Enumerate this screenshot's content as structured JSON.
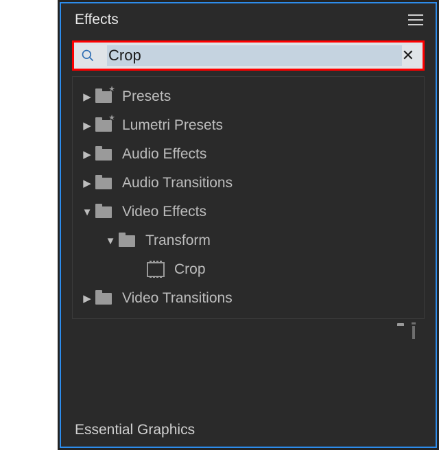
{
  "panel": {
    "title": "Effects"
  },
  "search": {
    "value": "Crop"
  },
  "tree": {
    "presets": "Presets",
    "lumetri": "Lumetri Presets",
    "audioFx": "Audio Effects",
    "audioTr": "Audio Transitions",
    "videoFx": "Video Effects",
    "transform": "Transform",
    "crop": "Crop",
    "videoTr": "Video Transitions"
  },
  "below": {
    "essentialGraphics": "Essential Graphics"
  }
}
